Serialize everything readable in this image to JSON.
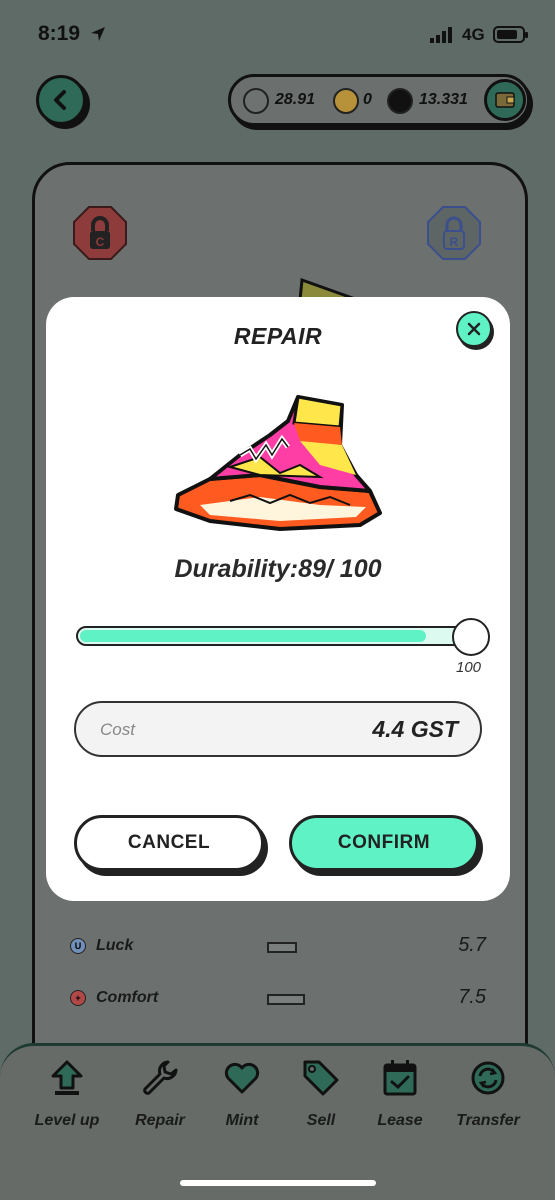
{
  "status_bar": {
    "time": "8:19",
    "network": "4G"
  },
  "wallet": {
    "coins": [
      {
        "icon": "shoe-token-icon",
        "value": "28.91",
        "color": "#6e7270"
      },
      {
        "icon": "gmt-token-icon",
        "value": "0",
        "color": "#b8923a"
      },
      {
        "icon": "sol-token-icon",
        "value": "13.331",
        "color": "#111111"
      }
    ]
  },
  "background": {
    "locks": [
      {
        "letter": "C",
        "color": "#8e3b3b"
      },
      {
        "letter": "R",
        "color": "#3b4f8e"
      }
    ],
    "attributes": [
      {
        "badge": "U",
        "label": "Luck",
        "value": "5.7",
        "badge_color": "#6f8fb8"
      },
      {
        "badge": "+",
        "label": "Comfort",
        "value": "7.5",
        "badge_color": "#b04848"
      }
    ]
  },
  "modal": {
    "title": "REPAIR",
    "durability_text": "Durability:89/ 100",
    "slider": {
      "value": 100,
      "max": 100,
      "max_label": "100",
      "fill_fraction": 0.86
    },
    "cost": {
      "label": "Cost",
      "value": "4.4 GST"
    },
    "cancel_label": "CANCEL",
    "confirm_label": "CONFIRM"
  },
  "nav": {
    "items": [
      {
        "label": "Level up",
        "icon": "level-up-icon"
      },
      {
        "label": "Repair",
        "icon": "wrench-icon"
      },
      {
        "label": "Mint",
        "icon": "heart-icon"
      },
      {
        "label": "Sell",
        "icon": "tag-icon"
      },
      {
        "label": "Lease",
        "icon": "calendar-icon"
      },
      {
        "label": "Transfer",
        "icon": "transfer-icon"
      }
    ]
  },
  "colors": {
    "accent": "#5ef2c4",
    "overlay": "#5f6b66",
    "dark_green": "#2e6a57"
  }
}
